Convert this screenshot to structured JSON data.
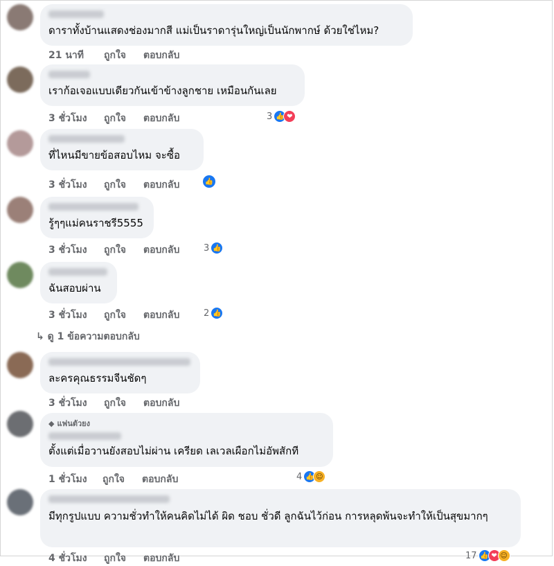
{
  "labels": {
    "like": "ถูกใจ",
    "reply": "ตอบกลับ"
  },
  "comments": [
    {
      "text": "ดาราทั้งบ้านแสดงช่องมากสี แม่เป็นราดารุ่นใหญ่เป็นนักพากษ์ ด้วยใช่ไหม?",
      "time": "21 นาที",
      "reaction_count": "",
      "reactions": []
    },
    {
      "text": "เราก้อเจอแบบเดียวกันเข้าข้างลูกชาย เหมือนกันเลย",
      "time": "3 ชั่วโมง",
      "reaction_count": "3",
      "reactions": [
        "like-icon",
        "love-icon"
      ]
    },
    {
      "text": "ที่ไหนมีขายข้อสอบไหม จะซื้อ",
      "time": "3 ชั่วโมง",
      "reaction_count": "",
      "reactions": [
        "like-icon"
      ]
    },
    {
      "text": "รู้ๆๆแม่คนราชรี5555",
      "time": "3 ชั่วโมง",
      "reaction_count": "3",
      "reactions": [
        "like-icon"
      ]
    },
    {
      "text": "ฉันสอบผ่าน",
      "time": "3 ชั่วโมง",
      "reaction_count": "2",
      "reactions": [
        "like-icon"
      ]
    },
    {
      "text": "ละครคุณธรรมจีนชัดๆ",
      "time": "3 ชั่วโมง",
      "reaction_count": "",
      "reactions": []
    },
    {
      "badge": "แฟนตัวยง",
      "text": "ตั้งแต่เมื่อวานยังสอบไม่ผ่าน เครียด เลเวลเผือกไม่อัพสักที",
      "time": "1 ชั่วโมง",
      "reaction_count": "4",
      "reactions": [
        "like-icon",
        "haha-icon"
      ]
    },
    {
      "text": "มีทุกรูปแบบ ความชั่วทำให้คนคิดไม่ได้ ผิด ชอบ ชั่วดี ลูกฉันไว้ก่อน การหลุดพ้นจะทำให้เป็นสุขมากๆ",
      "time": "4 ชั่วโมง",
      "reaction_count": "17",
      "reactions": [
        "like-icon",
        "love-icon",
        "haha-icon"
      ]
    }
  ],
  "view_replies": "ดู 1 ข้อความตอบกลับ"
}
